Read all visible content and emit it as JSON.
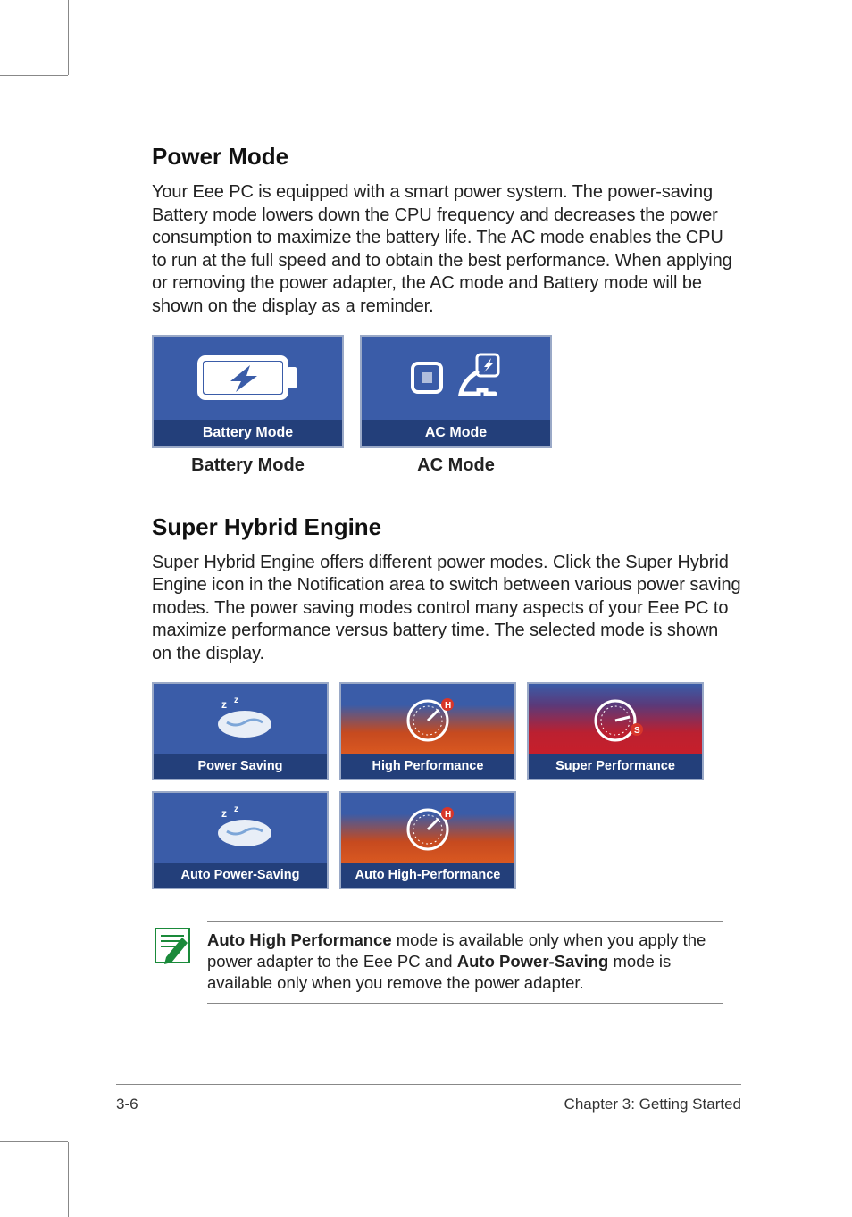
{
  "section1": {
    "heading": "Power Mode",
    "paragraph": "Your Eee PC is equipped with a smart power system. The power-saving Battery mode lowers down the CPU frequency and decreases the power consumption to maximize the battery life. The AC mode enables the CPU to run at the full speed and to obtain the best performance. When applying or removing the power adapter, the AC mode and Battery mode will be shown on the display as a reminder.",
    "card1_label": "Battery Mode",
    "card1_caption": "Battery Mode",
    "card2_label": "AC Mode",
    "card2_caption": "AC Mode"
  },
  "section2": {
    "heading": "Super Hybrid Engine",
    "paragraph": "Super Hybrid Engine offers different power modes. Click the Super Hybrid Engine icon in the Notification area to switch between various power saving modes. The power saving modes control many aspects of your Eee PC to maximize performance versus battery time. The selected mode is shown on the display.",
    "modes": {
      "m1": "Power Saving",
      "m2": "High Performance",
      "m3": "Super Performance",
      "m4": "Auto Power-Saving",
      "m5": "Auto High-Performance"
    }
  },
  "note": {
    "bold1": "Auto High Performance",
    "seg1": " mode is  available only when you apply the power adapter to the Eee PC and ",
    "bold2": "Auto Power-Saving",
    "seg2": " mode is available only when you remove the power adapter."
  },
  "footer": {
    "left": "3-6",
    "right": "Chapter 3: Getting Started"
  }
}
